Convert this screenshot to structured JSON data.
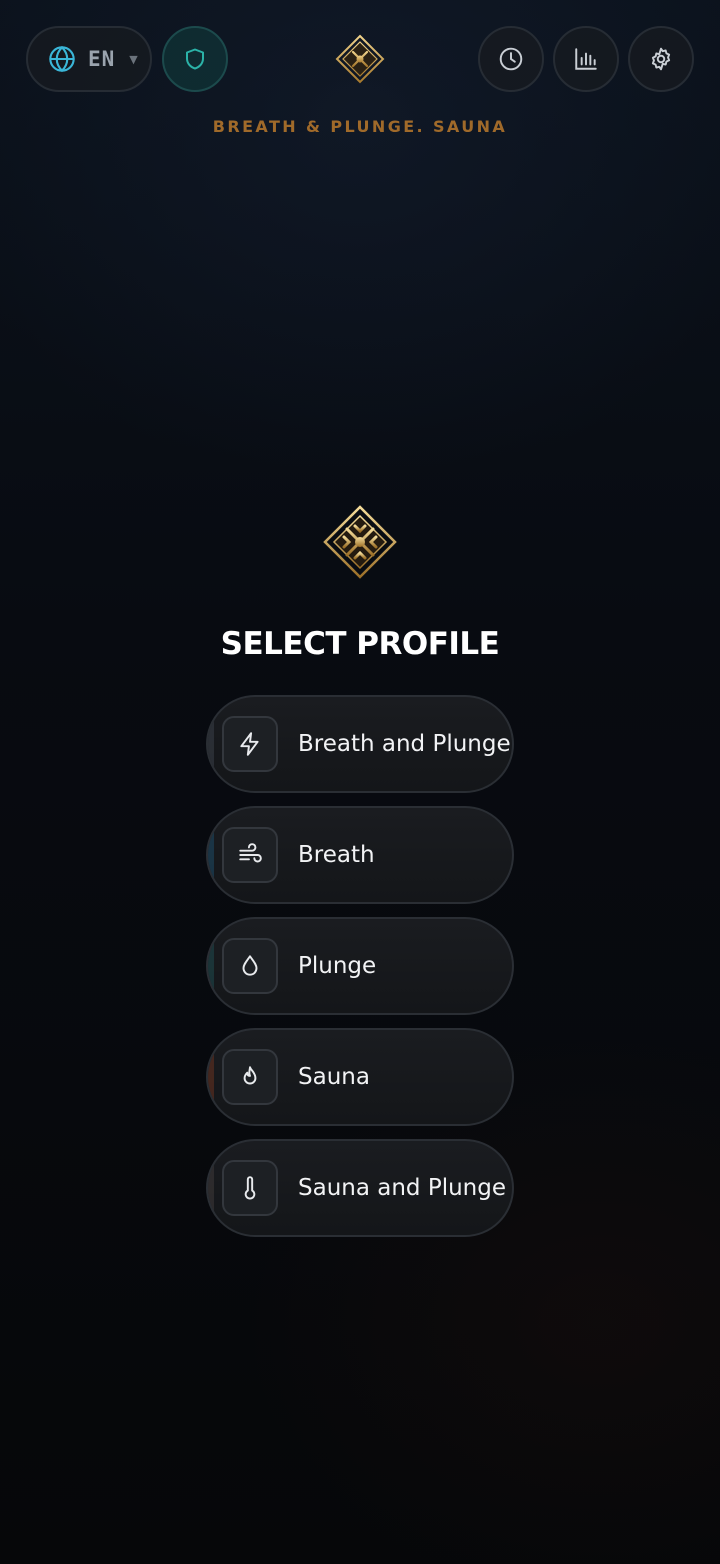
{
  "header": {
    "language_code": "EN",
    "tagline": "BREATH & PLUNGE. SAUNA",
    "icons": {
      "language": "globe-icon",
      "shield": "shield-icon",
      "history": "clock-icon",
      "stats": "bar-chart-icon",
      "settings": "gear-icon"
    }
  },
  "main": {
    "heading": "SELECT PROFILE",
    "profiles": [
      {
        "label": "Breath and Plunge",
        "icon": "lightning-icon",
        "accent": "#3a3f48"
      },
      {
        "label": "Breath",
        "icon": "wind-icon",
        "accent": "#1e4a66"
      },
      {
        "label": "Plunge",
        "icon": "droplet-icon",
        "accent": "#1f4a4f"
      },
      {
        "label": "Sauna",
        "icon": "flame-icon",
        "accent": "#6a3320"
      },
      {
        "label": "Sauna and Plunge",
        "icon": "thermometer-icon",
        "accent": "#3f3b3a"
      }
    ]
  },
  "colors": {
    "accent_teal": "#2bb3a8",
    "accent_cyan": "#3ab6d8",
    "tagline_gold": "#a06a2a",
    "logo_gold": "#d9b25a"
  }
}
